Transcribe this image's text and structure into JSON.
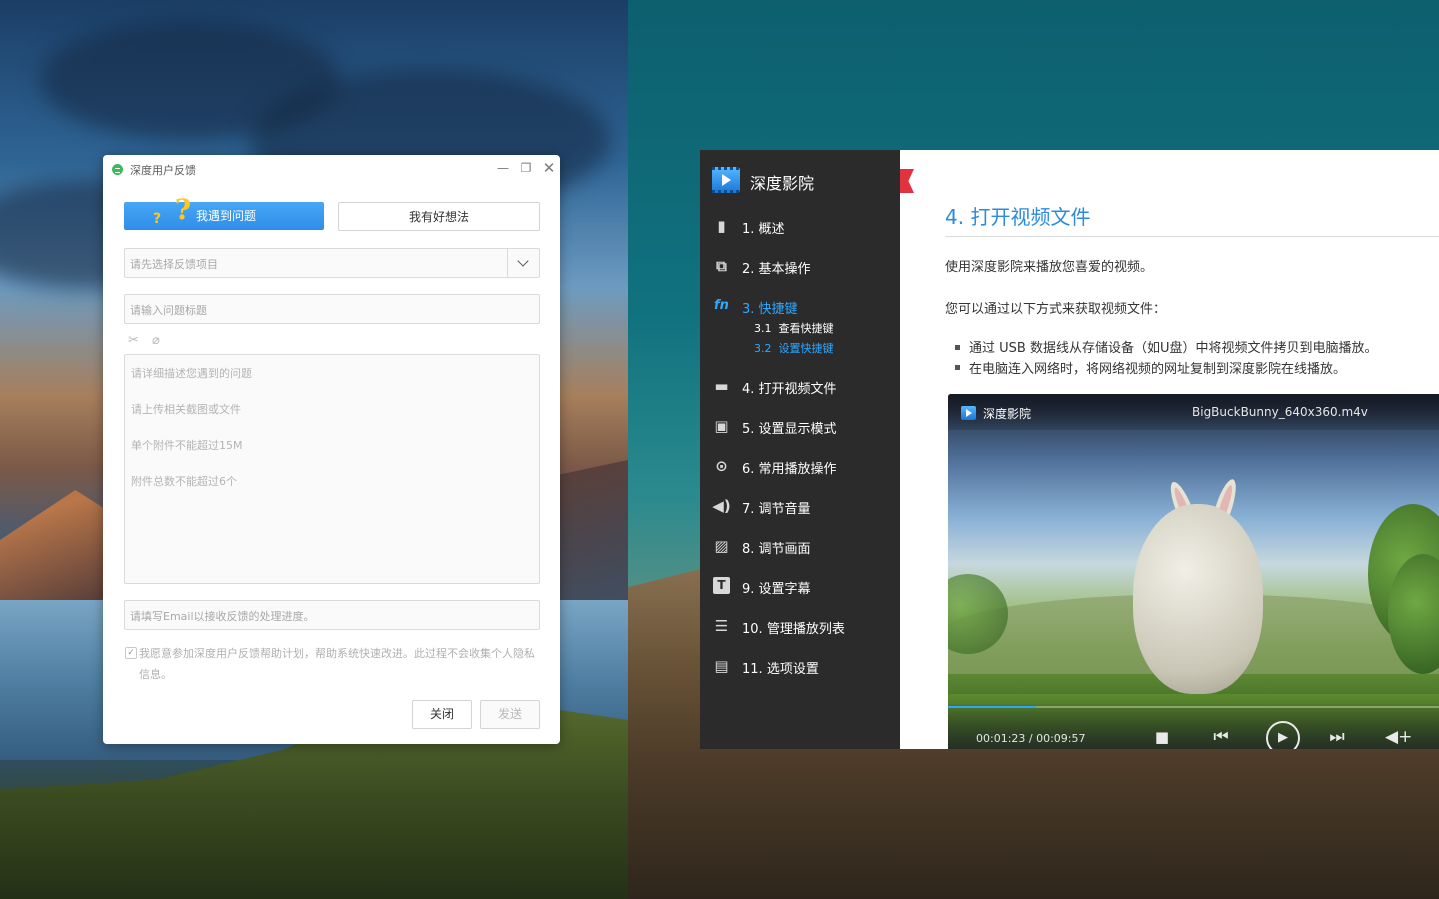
{
  "feedback": {
    "title": "深度用户反馈",
    "tab_problem": "我遇到问题",
    "tab_idea": "我有好想法",
    "select_placeholder": "请先选择反馈项目",
    "title_placeholder": "请输入问题标题",
    "description_lines": [
      "请详细描述您遇到的问题",
      "请上传相关截图或文件",
      "单个附件不能超过15M",
      "附件总数不能超过6个"
    ],
    "email_placeholder": "请填写Email以接收反馈的处理进度。",
    "agree_text": "我愿意参加深度用户反馈帮助计划，帮助系统快速改进。此过程不会收集个人隐私信息。",
    "close_label": "关闭",
    "send_label": "发送",
    "icons": {
      "app": "feedback-app-icon",
      "scissors": "screenshot-icon",
      "attach": "attachment-icon"
    },
    "accent_color": "#3da1ff"
  },
  "manual": {
    "app_name": "深度影院",
    "nav": [
      {
        "num": "1.",
        "label": "概述",
        "icon": "book-icon"
      },
      {
        "num": "2.",
        "label": "基本操作",
        "icon": "puzzle-icon"
      },
      {
        "num": "3.",
        "label": "快捷键",
        "icon": "fn-key-icon",
        "active": true
      },
      {
        "num": "4.",
        "label": "打开视频文件",
        "icon": "video-folder-icon"
      },
      {
        "num": "5.",
        "label": "设置显示模式",
        "icon": "display-mode-icon"
      },
      {
        "num": "6.",
        "label": "常用播放操作",
        "icon": "play-circle-icon"
      },
      {
        "num": "7.",
        "label": "调节音量",
        "icon": "volume-icon"
      },
      {
        "num": "8.",
        "label": "调节画面",
        "icon": "image-adjust-icon"
      },
      {
        "num": "9.",
        "label": "设置字幕",
        "icon": "subtitle-icon"
      },
      {
        "num": "10.",
        "label": "管理播放列表",
        "icon": "playlist-icon"
      },
      {
        "num": "11.",
        "label": "选项设置",
        "icon": "settings-list-icon"
      }
    ],
    "sub_nav": [
      {
        "num": "3.1",
        "label": "查看快捷键"
      },
      {
        "num": "3.2",
        "label": "设置快捷键",
        "active": true
      }
    ],
    "heading": "4. 打开视频文件",
    "para1": "使用深度影院来播放您喜爱的视频。",
    "para2": "您可以通过以下方式来获取视频文件：",
    "bullets": [
      "通过 USB 数据线从存储设备（如U盘）中将视频文件拷贝到电脑播放。",
      "在电脑连入网络时，将网络视频的网址复制到深度影院在线播放。"
    ],
    "player": {
      "app_name": "深度影院",
      "file_name": "BigBuckBunny_640x360.m4v",
      "time": "00:01:23 / 00:09:57",
      "progress": 0.18
    },
    "accent_color": "#2c8be0"
  }
}
